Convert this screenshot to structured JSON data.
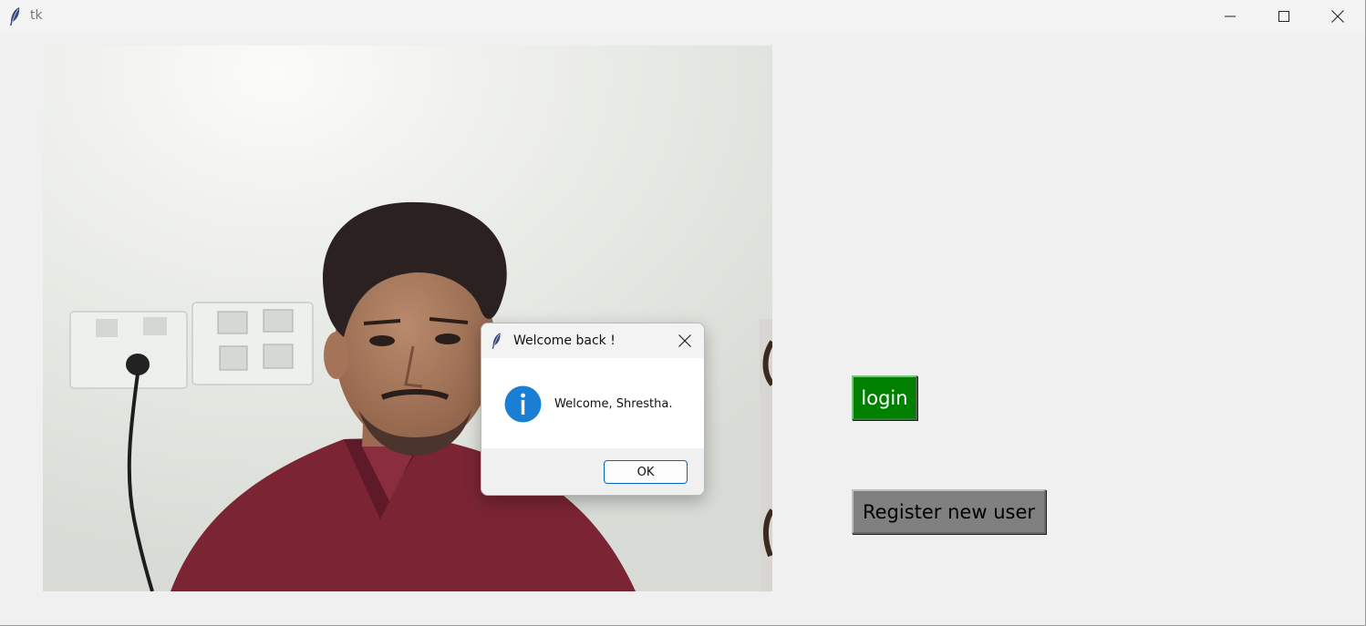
{
  "window": {
    "title": "tk",
    "icon": "tk-feather-icon"
  },
  "camera": {
    "description_icon": "webcam-frame"
  },
  "buttons": {
    "login_label": "login",
    "register_label": "Register new user"
  },
  "dialog": {
    "title": "Welcome back !",
    "message": "Welcome, Shrestha.",
    "ok_label": "OK",
    "icon": "info-icon"
  },
  "colors": {
    "login_bg": "#008000",
    "register_bg": "#808080",
    "info_blue": "#1a7fd4",
    "ok_border": "#0067c0"
  }
}
